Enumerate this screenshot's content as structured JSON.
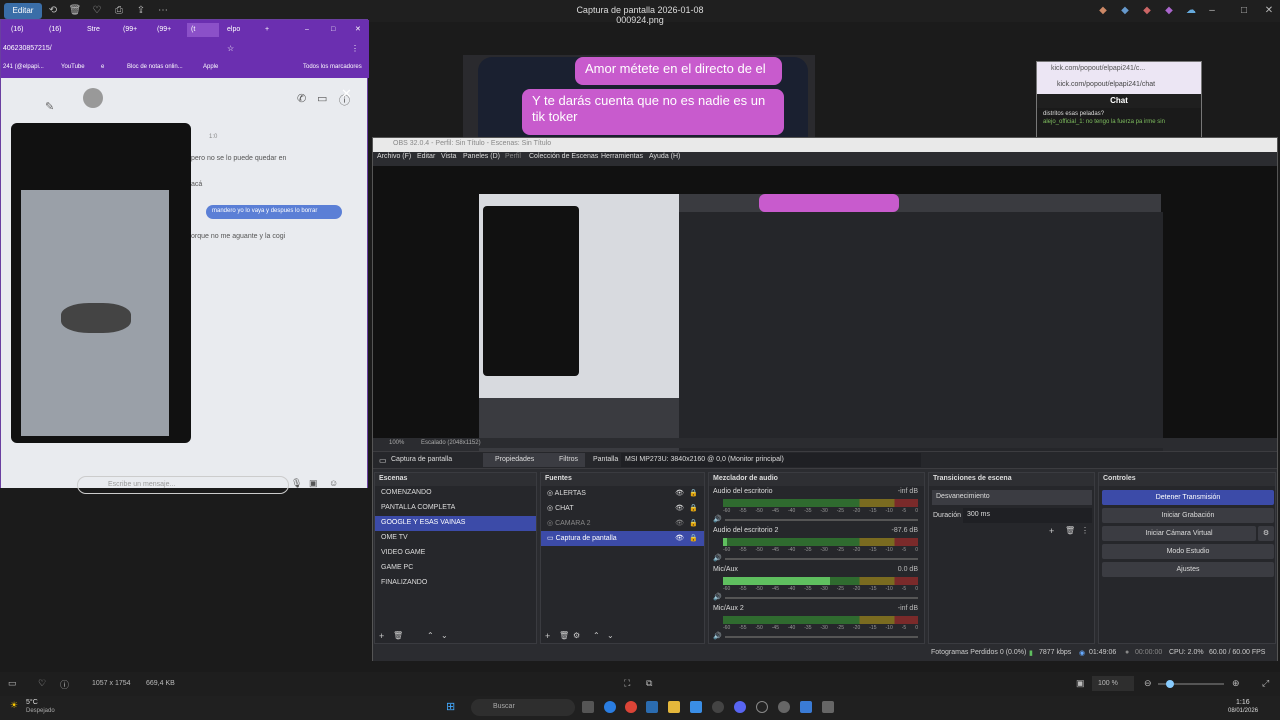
{
  "viewer": {
    "title": "Captura de pantalla 2026-01-08 000924.png",
    "edit_label": "Editar",
    "zoom": "100 %",
    "dimensions": "1057 x 1754",
    "filesize": "669,4 KB"
  },
  "chat_bubbles": [
    "Amor métete en el directo de el",
    "Y te darás cuenta que no es nadie es un tik toker"
  ],
  "browser": {
    "tabs": [
      "(16)",
      "(16)",
      "Stre",
      "(99+",
      "(99+",
      "(t",
      "elpo"
    ],
    "url": "406230857215/",
    "bookmarks": [
      "241 (@elpapi...",
      "YouTube",
      "e",
      "Bloc de notas onlin...",
      "Apple",
      "Todos los marcadores"
    ],
    "messages": [
      "pero no se lo puede quedar en",
      "acá",
      "mandero yo lo vaya y despues lo borrar",
      "orque no me aguante y la cogi",
      "1:0"
    ],
    "input_placeholder": "Escribe un mensaje..."
  },
  "kick": {
    "title": "kick.com/popout/elpapi241/c...",
    "url": "kick.com/popout/elpapi241/chat",
    "chat_label": "Chat",
    "line1": "distritos esas peladas?",
    "line2": "alejo_official_1: no tengo la fuerza pa irme sin"
  },
  "obs": {
    "title": "OBS 32.0.4 - Perfil: Sin Título - Escenas: Sin Título",
    "menu": [
      "Archivo (F)",
      "Editar",
      "Vista",
      "Paneles (D)",
      "Perfil",
      "Colección de Escenas",
      "Herramientas",
      "Ayuda (H)"
    ],
    "preview_status": [
      "100%",
      "Escalado (2048x1152)"
    ],
    "source_bar": {
      "source_name": "Captura de pantalla",
      "properties": "Propiedades",
      "filters": "Filtros",
      "screen_label": "Pantalla",
      "screen_value": "MSI MP273U: 3840x2160 @ 0,0 (Monitor principal)"
    },
    "scenes": {
      "title": "Escenas",
      "items": [
        "COMENZANDO",
        "PANTALLA COMPLETA",
        "GOOGLE Y ESAS VAINAS",
        "OME TV",
        "VIDEO  GAME",
        "GAME PC",
        "FINALIZANDO"
      ],
      "selected_index": 2
    },
    "sources": {
      "title": "Fuentes",
      "items": [
        "ALERTAS",
        "CHAT",
        "CAMARA 2",
        "Captura de pantalla"
      ],
      "selected_index": 3
    },
    "mixer": {
      "title": "Mezclador de audio",
      "channels": [
        {
          "name": "Audio del escritorio",
          "db": "-inf dB",
          "level": 0
        },
        {
          "name": "Audio del escritorio 2",
          "db": "-87.6 dB",
          "level": 0.02
        },
        {
          "name": "Mic/Aux",
          "db": "0.0 dB",
          "level": 0.55
        },
        {
          "name": "Mic/Aux 2",
          "db": "-inf dB",
          "level": 0
        }
      ],
      "scale": [
        "-60",
        "-55",
        "-50",
        "-45",
        "-40",
        "-35",
        "-30",
        "-25",
        "-20",
        "-15",
        "-10",
        "-5",
        "0"
      ]
    },
    "transitions": {
      "title": "Transiciones de escena",
      "type": "Desvanecimiento",
      "duration_label": "Duración",
      "duration_value": "300 ms"
    },
    "controls": {
      "title": "Controles",
      "buttons": [
        "Detener Transmisión",
        "Iniciar Grabación",
        "Iniciar Cámara Virtual",
        "Modo Estudio",
        "Ajustes"
      ]
    },
    "footer": {
      "dropped": "Fotogramas Perdidos 0 (0.0%)",
      "bitrate": "7877 kbps",
      "live_time": "01:49:06",
      "rec_time": "00:00:00",
      "cpu": "CPU: 2.0%",
      "fps": "60.00 / 60.00 FPS"
    }
  },
  "taskbar": {
    "weather_temp": "5°C",
    "weather_desc": "Despejado",
    "search": "Buscar",
    "time": "1:16",
    "date": "08/01/2026"
  }
}
